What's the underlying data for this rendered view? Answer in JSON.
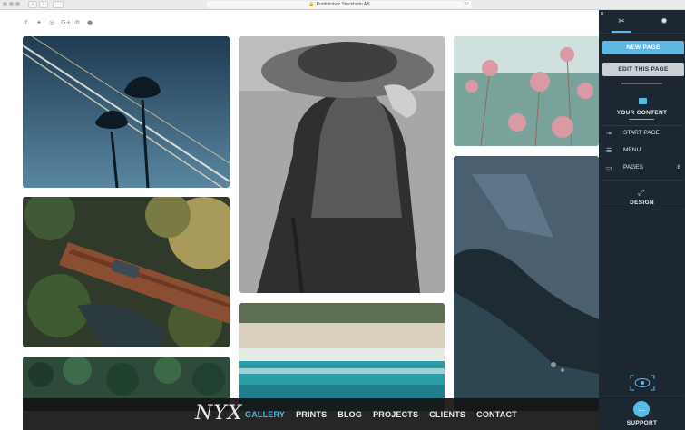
{
  "browser": {
    "address": "Portfoliobox Stockholm AB",
    "lock_icon": "🔒",
    "reload_icon": "↻",
    "back_icon": "‹",
    "forward_icon": "›"
  },
  "social": [
    {
      "name": "facebook-icon",
      "glyph": "f"
    },
    {
      "name": "twitter-icon",
      "glyph": "✦"
    },
    {
      "name": "instagram-icon",
      "glyph": "◎"
    },
    {
      "name": "google-plus-icon",
      "glyph": "G+"
    },
    {
      "name": "pinterest-icon",
      "glyph": "℗"
    },
    {
      "name": "flickr-icon",
      "glyph": "●"
    }
  ],
  "site": {
    "logo": "NYX",
    "menu": [
      {
        "label": "GALLERY",
        "active": true
      },
      {
        "label": "PRINTS",
        "active": false
      },
      {
        "label": "BLOG",
        "active": false
      },
      {
        "label": "PROJECTS",
        "active": false
      },
      {
        "label": "CLIENTS",
        "active": false
      },
      {
        "label": "CONTACT",
        "active": false
      }
    ],
    "accent": "#4fb7e6"
  },
  "panel": {
    "tools_icon": "✂",
    "settings_icon": "✹",
    "new_page": "NEW PAGE",
    "edit_page": "EDIT THIS PAGE",
    "your_content": "YOUR CONTENT",
    "start_page": "START PAGE",
    "menu": "MENU",
    "pages": "PAGES",
    "pages_count": "8",
    "design": "DESIGN",
    "support": "SUPPORT",
    "accent": "#5bb9e6",
    "background": "#1d2731"
  }
}
